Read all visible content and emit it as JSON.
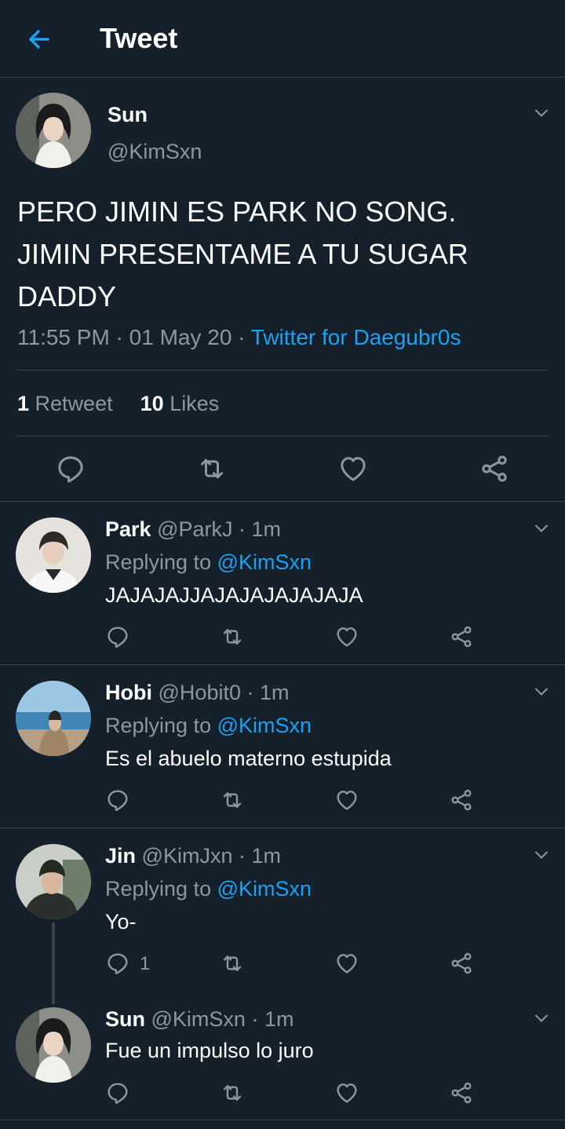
{
  "header": {
    "title": "Tweet"
  },
  "main_tweet": {
    "name": "Sun",
    "handle": "@KimSxn",
    "text": "PERO JIMIN ES PARK NO SONG. JIMIN PRESENTAME A TU SUGAR DADDY",
    "time": "11:55 PM · 01 May 20 · ",
    "source": "Twitter for Daegubr0s",
    "retweet_count": "1",
    "retweet_label": "Retweet",
    "likes_count": "10",
    "likes_label": "Likes"
  },
  "replies": [
    {
      "name": "Park",
      "handle": "@ParkJ",
      "time": " · 1m",
      "replying_prefix": "Replying to ",
      "replying_mention": "@KimSxn",
      "text": "JAJAJAJJAJAJAJAJAJAJA",
      "reply_count": ""
    },
    {
      "name": "Hobi",
      "handle": "@Hobit0",
      "time": " · 1m",
      "replying_prefix": "Replying to ",
      "replying_mention": "@KimSxn",
      "text": "Es el abuelo materno estupida",
      "reply_count": ""
    },
    {
      "name": "Jin",
      "handle": "@KimJxn",
      "time": " · 1m",
      "replying_prefix": "Replying to ",
      "replying_mention": "@KimSxn",
      "text": "Yo-",
      "reply_count": "1"
    },
    {
      "name": "Sun",
      "handle": "@KimSxn",
      "time": " · 1m",
      "text": "Fue un impulso lo juro",
      "reply_count": ""
    }
  ],
  "colors": {
    "background": "#15202b",
    "divider": "#38444d",
    "secondary_text": "#8899a6",
    "accent": "#1da1f2"
  },
  "icons": [
    "back-arrow-icon",
    "chevron-down-icon",
    "reply-icon",
    "retweet-icon",
    "like-icon",
    "share-icon"
  ]
}
